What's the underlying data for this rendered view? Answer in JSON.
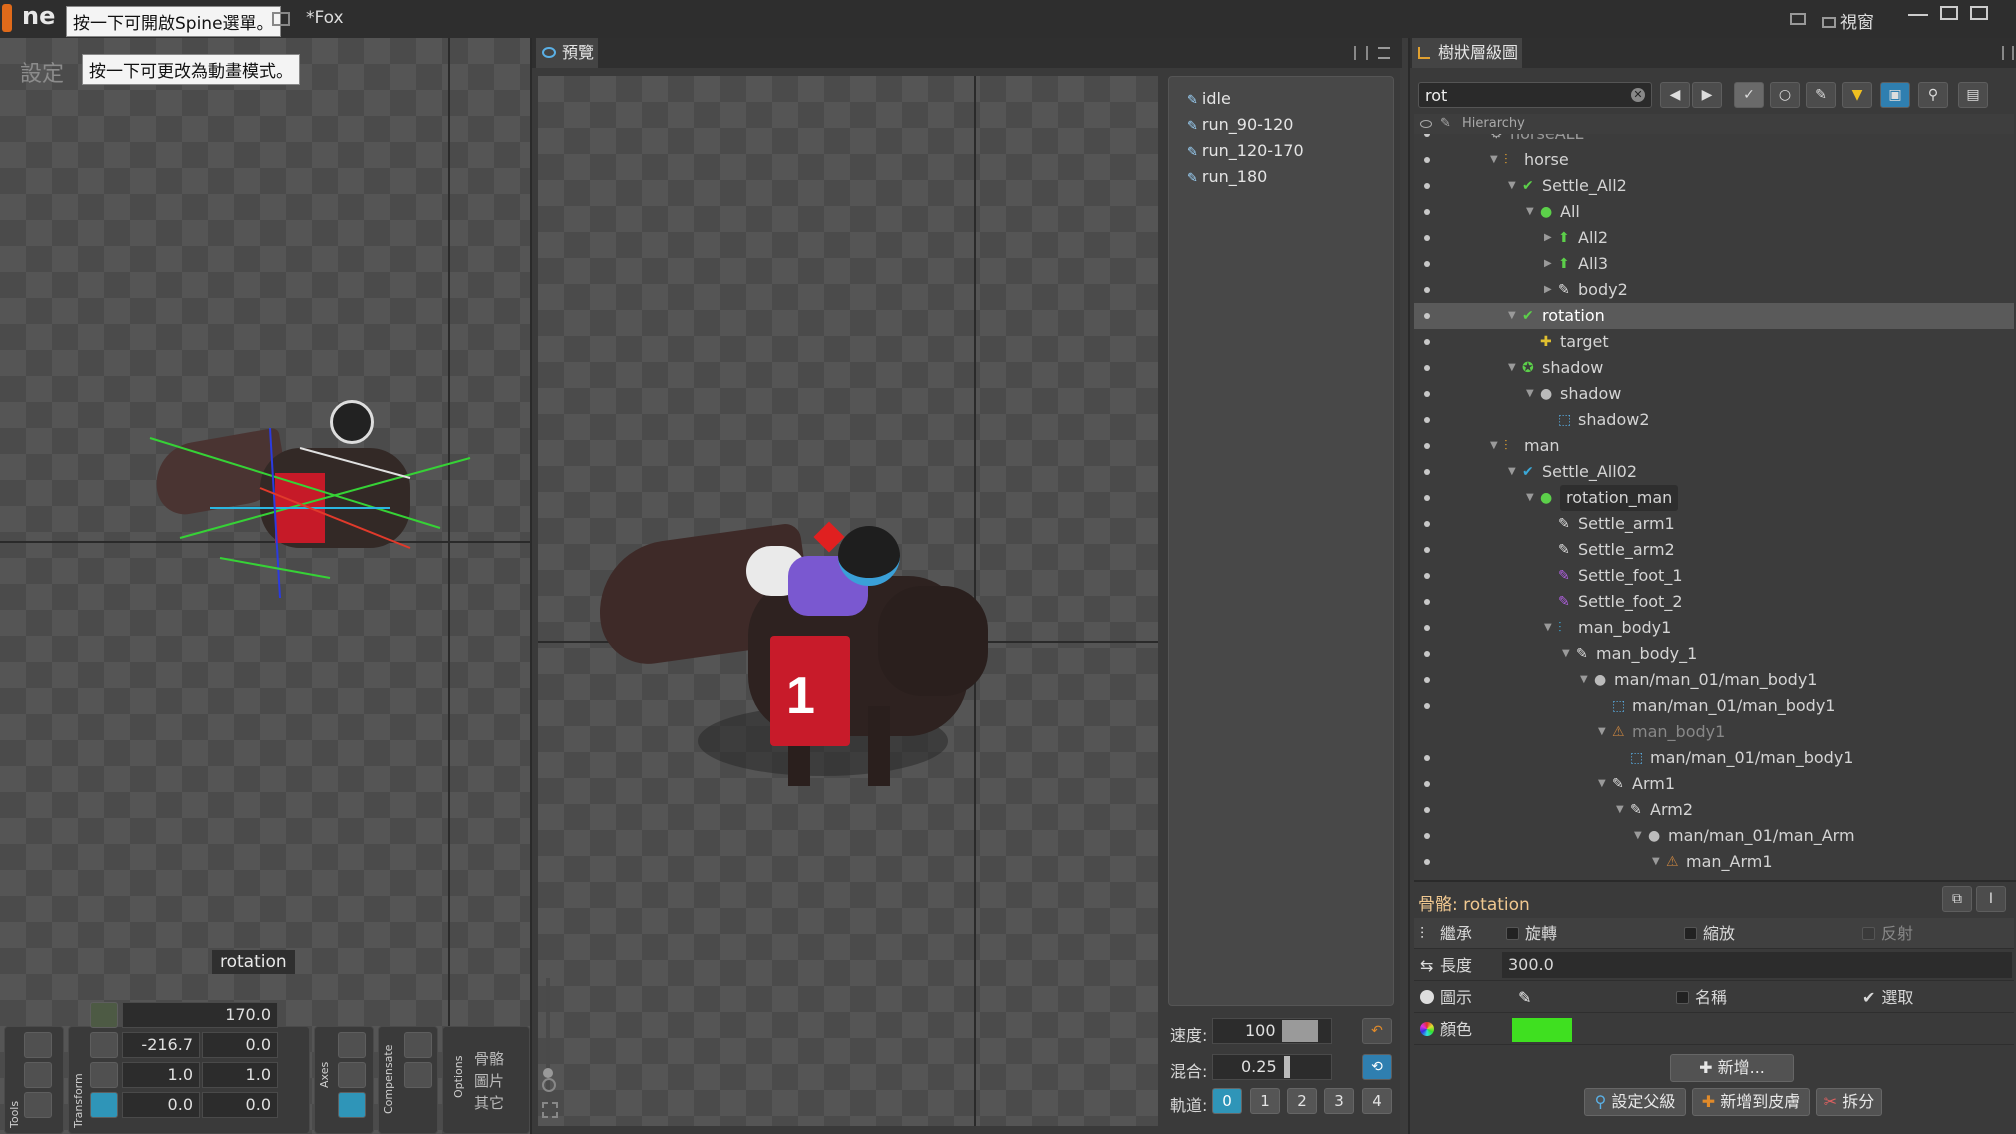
{
  "titlebar": {
    "logo_text": "ne",
    "menu_tip": "按一下可開啟Spine選單。",
    "file_name": "*Fox",
    "view_label": "視窗"
  },
  "left_viewport": {
    "setup_label": "設定",
    "mode_tip": "按一下可更改為動畫模式。",
    "selected_bone_label": "rotation",
    "transform": {
      "rotate": "170.0",
      "translate_x": "-216.7",
      "translate_y": "0.0",
      "scale_x": "1.0",
      "scale_y": "1.0",
      "shear_x": "0.0",
      "shear_y": "0.0"
    },
    "group_labels": {
      "tools": "Tools",
      "transform": "Transform",
      "axes": "Axes",
      "compensate": "Compensate",
      "options": "Options"
    },
    "options": [
      "骨骼",
      "圖片",
      "其它"
    ]
  },
  "preview": {
    "tab_label": "預覽",
    "animations": [
      "idle",
      "run_90-120",
      "run_120-170",
      "run_180"
    ],
    "speed_label": "速度:",
    "speed_value": "100",
    "mix_label": "混合:",
    "mix_value": "0.25",
    "track_label": "軌道:",
    "tracks": [
      "0",
      "1",
      "2",
      "3",
      "4"
    ],
    "race_number": "1"
  },
  "tree": {
    "tab_label": "樹狀層級圖",
    "search_value": "rot",
    "header_label": "Hierarchy",
    "rows": [
      {
        "label": "horseALL",
        "depth": 0
      },
      {
        "label": "horse",
        "depth": 1
      },
      {
        "label": "Settle_All2",
        "depth": 2
      },
      {
        "label": "All",
        "depth": 3
      },
      {
        "label": "All2",
        "depth": 4
      },
      {
        "label": "All3",
        "depth": 4
      },
      {
        "label": "body2",
        "depth": 4
      },
      {
        "label": "rotation",
        "depth": 2
      },
      {
        "label": "target",
        "depth": 3
      },
      {
        "label": "shadow",
        "depth": 2
      },
      {
        "label": "shadow",
        "depth": 3
      },
      {
        "label": "shadow2",
        "depth": 4
      },
      {
        "label": "man",
        "depth": 1
      },
      {
        "label": "Settle_All02",
        "depth": 2
      },
      {
        "label": "rotation_man",
        "depth": 3
      },
      {
        "label": "Settle_arm1",
        "depth": 4
      },
      {
        "label": "Settle_arm2",
        "depth": 4
      },
      {
        "label": "Settle_foot_1",
        "depth": 4
      },
      {
        "label": "Settle_foot_2",
        "depth": 4
      },
      {
        "label": "man_body1",
        "depth": 4
      },
      {
        "label": "man_body_1",
        "depth": 5
      },
      {
        "label": "man/man_01/man_body1",
        "depth": 6
      },
      {
        "label": "man/man_01/man_body1",
        "depth": 7
      },
      {
        "label": "man_body1",
        "depth": 6
      },
      {
        "label": "man/man_01/man_body1",
        "depth": 8
      },
      {
        "label": "Arm1",
        "depth": 6
      },
      {
        "label": "Arm2",
        "depth": 7
      },
      {
        "label": "man/man_01/man_Arm",
        "depth": 8
      },
      {
        "label": "man_Arm1",
        "depth": 9
      }
    ]
  },
  "properties": {
    "title": "骨骼: rotation",
    "inherit_label": "繼承",
    "rotate_label": "旋轉",
    "scale_label": "縮放",
    "reflect_label": "反射",
    "length_label": "長度",
    "length_value": "300.0",
    "icon_label": "圖示",
    "name_label": "名稱",
    "select_label": "選取",
    "color_label": "顏色",
    "color_value": "#3fe020",
    "new_button": "新增...",
    "set_parent_button": "設定父級",
    "add_to_skin_button": "新增到皮膚",
    "split_button": "拆分"
  }
}
